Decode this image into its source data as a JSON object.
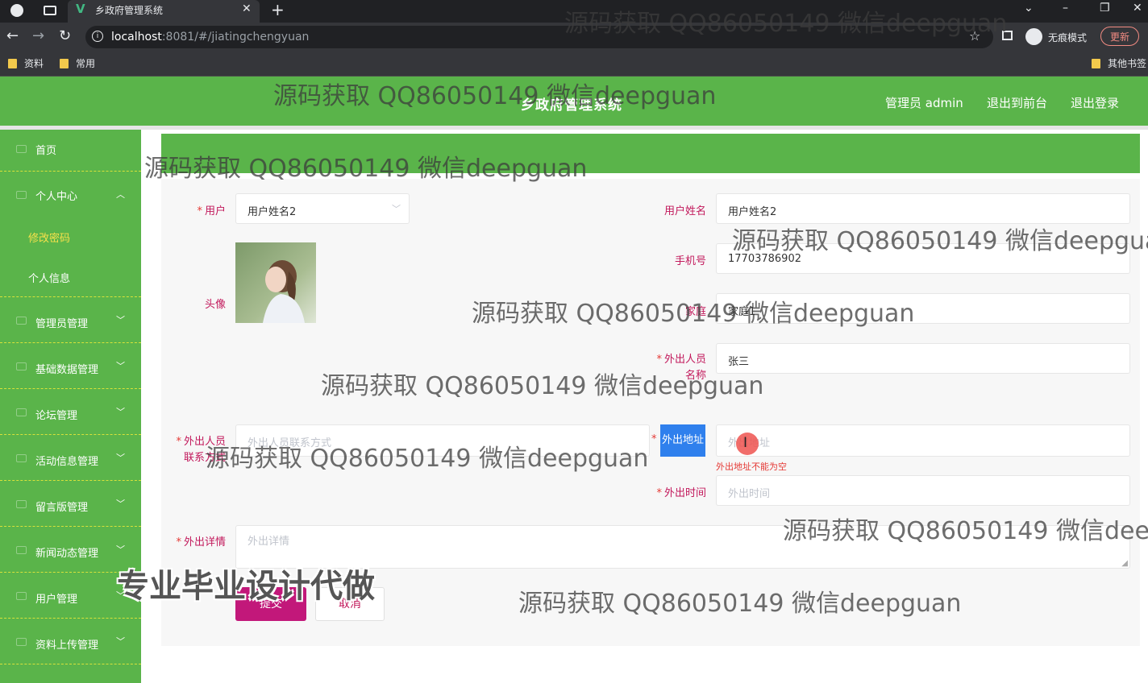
{
  "browser": {
    "tab_title": "乡政府管理系统",
    "url_host": "localhost",
    "url_port_path": ":8081/#/jiatingchengyuan",
    "incognito_label": "无痕模式",
    "update_label": "更新",
    "bookmarks": [
      "资料",
      "常用"
    ],
    "other_bookmarks": "其他书签"
  },
  "header": {
    "title": "乡政府管理系统",
    "admin": "管理员 admin",
    "to_front": "退出到前台",
    "logout": "退出登录"
  },
  "sidebar": {
    "home": "首页",
    "personal_center": "个人中心",
    "change_password": "修改密码",
    "personal_info": "个人信息",
    "items": [
      "管理员管理",
      "基础数据管理",
      "论坛管理",
      "活动信息管理",
      "留言版管理",
      "新闻动态管理",
      "用户管理",
      "资料上传管理"
    ]
  },
  "form": {
    "user_label": "用户",
    "user_value": "用户姓名2",
    "username_label": "用户姓名",
    "username_value": "用户姓名2",
    "phone_label": "手机号",
    "phone_value": "17703786902",
    "avatar_label": "头像",
    "family_label": "家庭",
    "family_value": "家庭1",
    "outperson_label_1": "外出人员",
    "outperson_label_2": "名称",
    "outperson_value": "张三",
    "contact_label_1": "外出人员",
    "contact_label_2": "联系方式",
    "contact_placeholder": "外出人员联系方式",
    "address_label": "外出地址",
    "address_placeholder": "外出地址",
    "address_error": "外出地址不能为空",
    "time_label": "外出时间",
    "time_placeholder": "外出时间",
    "detail_label": "外出详情",
    "detail_placeholder": "外出详情",
    "submit": "提交",
    "cancel": "取消"
  },
  "watermarks": {
    "line": "源码获取 QQ86050149 微信deepguan",
    "line_cut_1": "源码获取 QQ86050149 微信deepgua",
    "line_cut_2": "源码获取 QQ86050149 微信deep",
    "big": "专业毕业设计代做"
  },
  "colors": {
    "accent_green": "#5ab44a",
    "primary_magenta": "#c2187a",
    "label_pink": "#c2185b",
    "highlight_blue": "#2f80ed",
    "error_red": "#e53935"
  }
}
